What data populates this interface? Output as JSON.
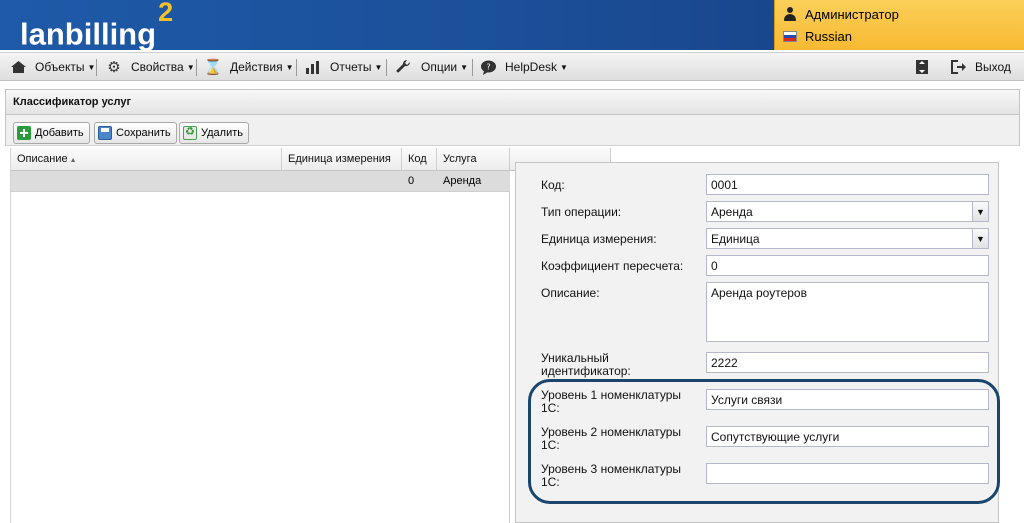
{
  "header": {
    "logo_text": "lanbilling",
    "logo_sup": "2",
    "user_name": "Администратор",
    "language": "Russian"
  },
  "menu": {
    "items": [
      {
        "label": "Объекты",
        "icon": "house-icon"
      },
      {
        "label": "Свойства",
        "icon": "gear-icon"
      },
      {
        "label": "Действия",
        "icon": "hourglass-icon"
      },
      {
        "label": "Отчеты",
        "icon": "bar-chart-icon"
      },
      {
        "label": "Опции",
        "icon": "wrench-icon"
      },
      {
        "label": "HelpDesk",
        "icon": "chat-bubble-icon"
      }
    ],
    "logout_label": "Выход"
  },
  "panel": {
    "title": "Классификатор услуг"
  },
  "toolbar": {
    "add_label": "Добавить",
    "save_label": "Сохранить",
    "delete_label": "Удалить"
  },
  "grid": {
    "columns": [
      "Описание",
      "Единица измерения",
      "Код",
      "Услуга"
    ],
    "rows": [
      [
        "",
        "",
        "0",
        "Аренда"
      ]
    ]
  },
  "form": {
    "code_label": "Код:",
    "code_value": "0001",
    "op_type_label": "Тип операции:",
    "op_type_value": "Аренда",
    "unit_label": "Единица измерения:",
    "unit_value": "Единица",
    "coef_label": "Коэффициент пересчета:",
    "coef_value": "0",
    "desc_label": "Описание:",
    "desc_value": "Аренда роутеров",
    "uid_label": "Уникальный идентификатор:",
    "uid_value": "2222",
    "nom1_label": "Уровень 1 номенклатуры 1С:",
    "nom1_value": "Услуги связи",
    "nom2_label": "Уровень 2 номенклатуры 1С:",
    "nom2_value": "Сопутствующие услуги",
    "nom3_label": "Уровень 3 номенклатуры 1С:",
    "nom3_value": ""
  },
  "colors": {
    "header_blue": "#1e5aa8",
    "userbox_yellow": "#f7b931",
    "highlight_border": "#1a466e"
  }
}
